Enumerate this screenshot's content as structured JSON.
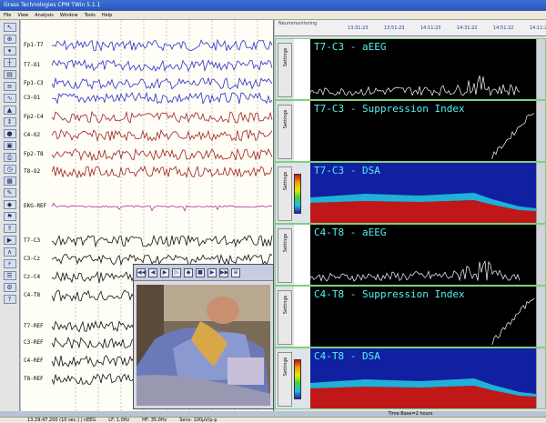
{
  "window": {
    "title": "Grass Technologies CPM TWin 5.1.1"
  },
  "menu": [
    "File",
    "View",
    "Analysis",
    "Window",
    "Tools",
    "Help"
  ],
  "toolbar_icons": [
    "cursor-icon",
    "zoom-icon",
    "marker-icon",
    "ruler-icon",
    "page-icon",
    "montage-icon",
    "filter-icon",
    "gain-icon",
    "scale-icon",
    "record-icon",
    "video-icon",
    "print-icon",
    "clock-icon",
    "calendar-icon",
    "notes-icon",
    "event-icon",
    "flag-icon",
    "export-icon",
    "review-icon",
    "spike-icon",
    "seizure-icon",
    "report-icon",
    "settings-icon",
    "help-icon"
  ],
  "eeg": {
    "channels": [
      "Fp1-T7",
      "T7-O1",
      "Fp1-C3",
      "C3-O1",
      "Fp2-C4",
      "C4-O2",
      "Fp2-T8",
      "T8-O2",
      "EKG-REF",
      "T7-C3",
      "C3-Cz",
      "Cz-C4",
      "C4-T8",
      "T7-REF",
      "C3-REF",
      "C4-REF",
      "T8-REF"
    ],
    "channel_colors": [
      "#2830c8",
      "#2830c8",
      "#2830c8",
      "#2830c8",
      "#a02020",
      "#a02020",
      "#a02020",
      "#a02020",
      "#b030b0",
      "#101010",
      "#101010",
      "#101010",
      "#101010",
      "#101010",
      "#101010",
      "#101010",
      "#101010"
    ]
  },
  "trends": {
    "window_title": "Neuromonitoring",
    "times": [
      "13:31:23",
      "13:51:23",
      "14:11:23",
      "14:31:22",
      "14:51:22",
      "14:11:22",
      "14:31:22",
      "14:51:22"
    ],
    "settings_label": "Settings",
    "panels": [
      {
        "title": "T7-C3 - aEEG",
        "kind": "aeeg"
      },
      {
        "title": "T7-C3 - Suppression Index",
        "kind": "si"
      },
      {
        "title": "T7-C3 - DSA",
        "kind": "dsa"
      },
      {
        "title": "C4-T8 - aEEG",
        "kind": "aeeg"
      },
      {
        "title": "C4-T8 - Suppression Index",
        "kind": "si"
      },
      {
        "title": "C4-T8 - DSA",
        "kind": "dsa"
      }
    ],
    "footer": "Time Base=2 hours"
  },
  "video": {
    "controls": [
      "◀◀",
      "◀",
      "▶",
      "▷",
      "◆",
      "■",
      "▶",
      "▶▶",
      "⊕"
    ]
  },
  "status": [
    "13:29:47.200 (10 sec.) | nEEG",
    "LF: 1.0Hz",
    "HF: 35.0Hz",
    "Sens: 100μV/p-p"
  ]
}
